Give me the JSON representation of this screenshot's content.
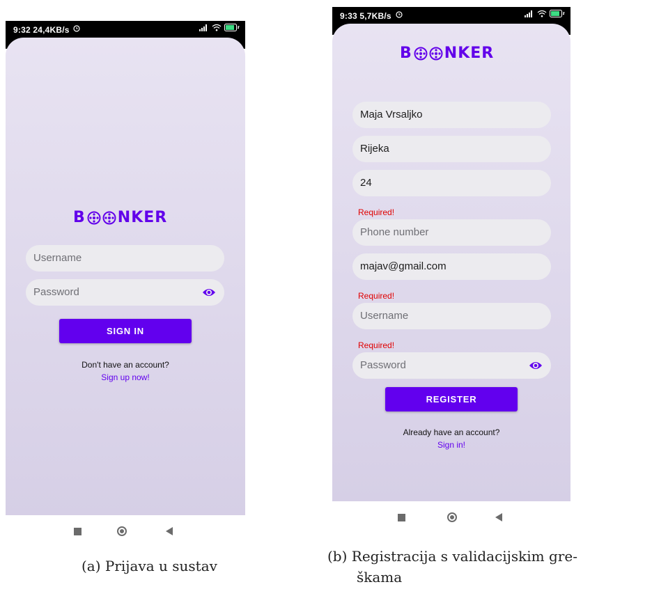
{
  "login": {
    "status": {
      "time": "9:32",
      "speed": "24,4KB/s"
    },
    "logo": {
      "prefix": "B",
      "suffix": "NKER"
    },
    "username_placeholder": "Username",
    "password_placeholder": "Password",
    "sign_in_label": "SIGN IN",
    "no_account_text": "Don't have an account?",
    "sign_up_link": "Sign up now!",
    "caption": "(a) Prijava u sustav"
  },
  "register": {
    "status": {
      "time": "9:33",
      "speed": "5,7KB/s"
    },
    "logo": {
      "prefix": "B",
      "suffix": "NKER"
    },
    "name_value": "Maja Vrsaljko",
    "city_value": "Rijeka",
    "age_value": "24",
    "phone_error": "Required!",
    "phone_placeholder": "Phone number",
    "email_value": "majav@gmail.com",
    "username_error": "Required!",
    "username_placeholder": "Username",
    "password_error": "Required!",
    "password_placeholder": "Password",
    "register_label": "REGISTER",
    "have_account_text": "Already have an account?",
    "sign_in_link": "Sign in!",
    "caption_line1": "(b) Registracija s validacijskim gre-",
    "caption_line2": "škama"
  },
  "colors": {
    "accent": "#6200ee",
    "error": "#e00000",
    "field_bg": "#ecebef",
    "gradient_top": "#e8e3f2",
    "gradient_bottom": "#d6cfe6"
  },
  "icons": [
    "alarm-icon",
    "signal-icon",
    "wifi-icon",
    "battery-icon",
    "eye-icon",
    "reel-icon",
    "nav-square-icon",
    "nav-home-icon",
    "nav-back-icon"
  ]
}
